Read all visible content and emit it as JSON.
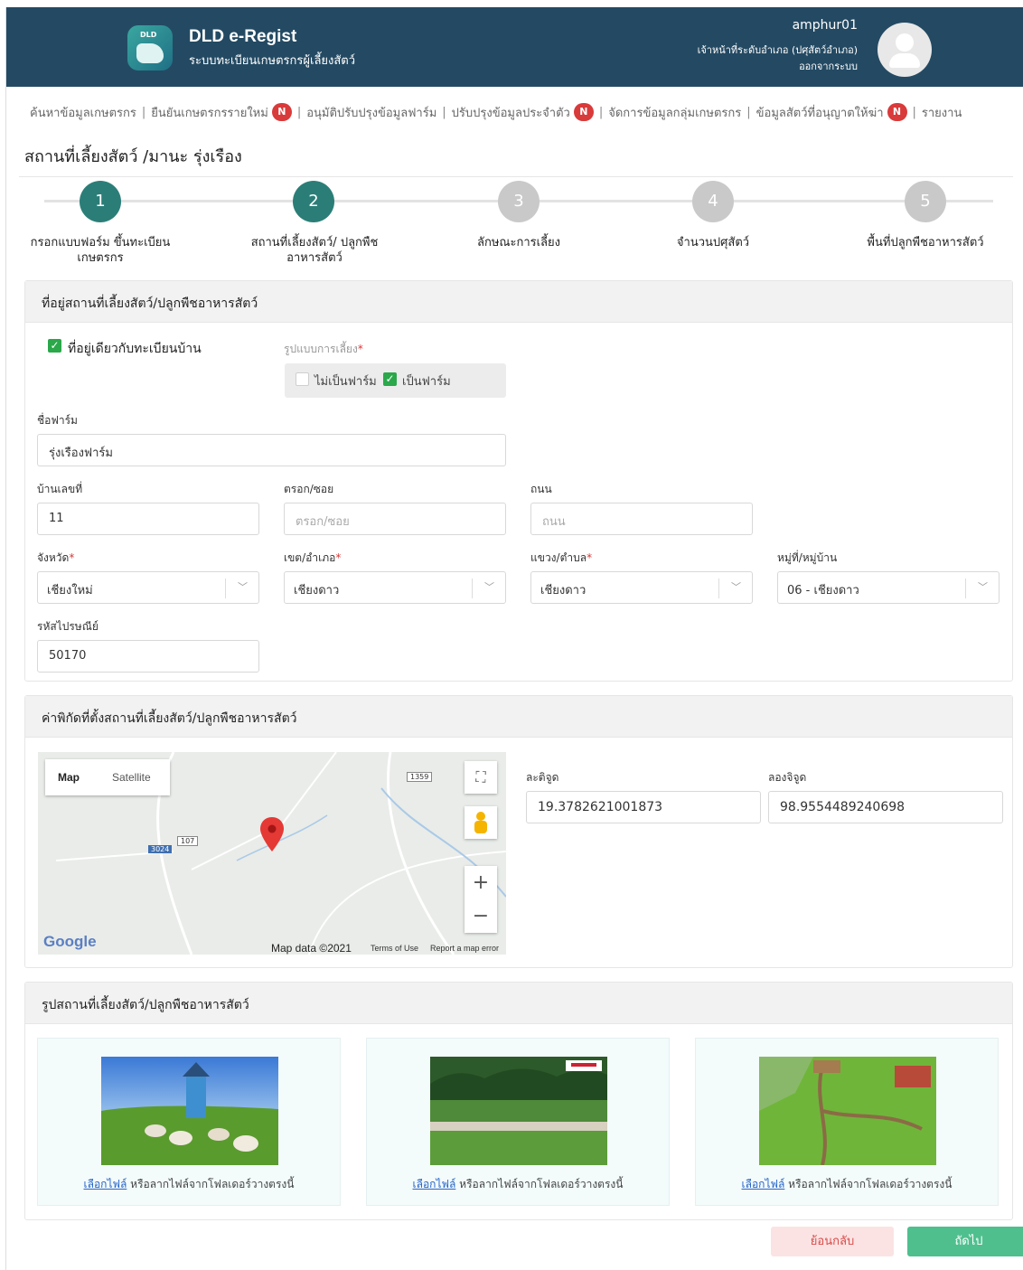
{
  "header": {
    "app_title": "DLD e-Regist",
    "app_subtitle": "ระบบทะเบียนเกษตรกรผู้เลี้ยงสัตว์",
    "logo_caption": "DLD",
    "username": "amphur01",
    "role": "เจ้าหน้าที่ระดับอำเภอ (ปศุสัตว์อำเภอ)",
    "logout": "ออกจากระบบ",
    "header_color": "#244a63"
  },
  "nav": {
    "items": [
      {
        "label": "ค้นหาข้อมูลเกษตรกร",
        "badge": ""
      },
      {
        "label": "ยืนยันเกษตรกรรายใหม่",
        "badge": "N"
      },
      {
        "label": "อนุมัติปรับปรุงข้อมูลฟาร์ม",
        "badge": ""
      },
      {
        "label": "ปรับปรุงข้อมูลประจำตัว",
        "badge": "N"
      },
      {
        "label": "จัดการข้อมูลกลุ่มเกษตรกร",
        "badge": ""
      },
      {
        "label": "ข้อมูลสัตว์ที่อนุญาตให้ฆ่า",
        "badge": "N"
      },
      {
        "label": "รายงาน",
        "badge": ""
      }
    ]
  },
  "page": {
    "title": "สถานที่เลี้ยงสัตว์ /มานะ รุ่งเรือง"
  },
  "steps": [
    {
      "num": "1",
      "label": "กรอกแบบฟอร์ม ขึ้นทะเบียนเกษตรกร",
      "state": "done"
    },
    {
      "num": "2",
      "label": "สถานที่เลี้ยงสัตว์/ ปลูกพืชอาหารสัตว์",
      "state": "active"
    },
    {
      "num": "3",
      "label": "ลักษณะการเลี้ยง",
      "state": "todo"
    },
    {
      "num": "4",
      "label": "จำนวนปศุสัตว์",
      "state": "todo"
    },
    {
      "num": "5",
      "label": "พื้นที่ปลูกพืชอาหารสัตว์",
      "state": "todo"
    }
  ],
  "address": {
    "section_title": "ที่อยู่สถานที่เลี้ยงสัตว์/ปลูกพืชอาหารสัตว์",
    "same_as_house_label": "ที่อยู่เดียวกับทะเบียนบ้าน",
    "same_as_house_checked": true,
    "farm_type_label": "รูปแบบการเลี้ยง",
    "not_farm_label": "ไม่เป็นฟาร์ม",
    "is_farm_label": "เป็นฟาร์ม",
    "is_farm_checked": true,
    "farm_name_label": "ชื่อฟาร์ม",
    "farm_name_value": "รุ่งเรืองฟาร์ม",
    "house_no_label": "บ้านเลขที่",
    "house_no_value": "11",
    "alley_label": "ตรอก/ซอย",
    "alley_placeholder": "ตรอก/ซอย",
    "road_label": "ถนน",
    "road_placeholder": "ถนน",
    "province_label": "จังหวัด",
    "province_value": "เชียงใหม่",
    "district_label": "เขต/อำเภอ",
    "district_value": "เชียงดาว",
    "subdistrict_label": "แขวง/ตำบล",
    "subdistrict_value": "เชียงดาว",
    "village_label": "หมู่ที่/หมู่บ้าน",
    "village_value": "06 - เชียงดาว",
    "postal_label": "รหัสไปรษณีย์",
    "postal_value": "50170",
    "required_mark": "*"
  },
  "coords": {
    "section_title": "ค่าพิกัดที่ตั้งสถานที่เลี้ยงสัตว์/ปลูกพืชอาหารสัตว์",
    "map_tab": "Map",
    "satellite_tab": "Satellite",
    "map_data": "Map data ©2021",
    "terms": "Terms of Use",
    "report": "Report a map error",
    "google": "Google",
    "road_1359": "1359",
    "road_107": "107",
    "road_3024": "3024",
    "lat_label": "ละติจูด",
    "lat_value": "19.3782621001873",
    "lng_label": "ลองจิจูด",
    "lng_value": "98.9554489240698"
  },
  "photos": {
    "section_title": "รูปสถานที่เลี้ยงสัตว์/ปลูกพืชอาหารสัตว์",
    "items": [
      {
        "link": "เลือกไฟล์",
        "hint": "หรือลากไฟล์จากโฟลเดอร์วางตรงนี้"
      },
      {
        "link": "เลือกไฟล์",
        "hint": "หรือลากไฟล์จากโฟลเดอร์วางตรงนี้"
      },
      {
        "link": "เลือกไฟล์",
        "hint": "หรือลากไฟล์จากโฟลเดอร์วางตรงนี้"
      }
    ]
  },
  "actions": {
    "back": "ย้อนกลับ",
    "next": "ถัดไป"
  }
}
